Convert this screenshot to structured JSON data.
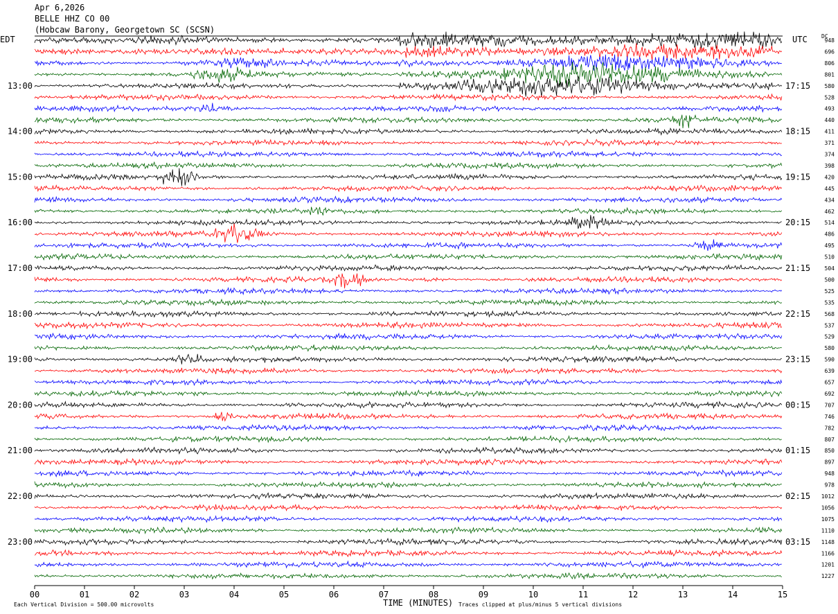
{
  "header": {
    "date": "Apr 6,2026",
    "station": "BELLE HHZ CO 00",
    "location": "(Hobcaw Barony, Georgetown SC (SCSN)"
  },
  "left_timezone": "EDT",
  "right_timezone": "UTC",
  "dc_header": "DC",
  "chart_data": {
    "type": "line",
    "subtype": "helicorder",
    "xlabel": "TIME (MINUTES)",
    "x_ticks": [
      "00",
      "01",
      "02",
      "03",
      "04",
      "05",
      "06",
      "07",
      "08",
      "09",
      "10",
      "11",
      "12",
      "13",
      "14",
      "15"
    ],
    "xlim": [
      0,
      15
    ],
    "rows_per_hour": 4,
    "minutes_per_row": 15,
    "row_count": 48,
    "trace_colors": [
      "#000000",
      "#ff0000",
      "#0000ff",
      "#006400"
    ],
    "left_hour_labels": [
      "13:00",
      "14:00",
      "15:00",
      "16:00",
      "17:00",
      "18:00",
      "19:00",
      "20:00",
      "21:00",
      "22:00",
      "23:00"
    ],
    "right_hour_labels": [
      "17:15",
      "18:15",
      "19:15",
      "20:15",
      "21:15",
      "22:15",
      "23:15",
      "00:15",
      "01:15",
      "02:15",
      "03:15"
    ],
    "dc_offsets": [
      948,
      696,
      806,
      801,
      580,
      528,
      493,
      440,
      411,
      371,
      374,
      398,
      420,
      445,
      434,
      462,
      514,
      486,
      495,
      510,
      504,
      500,
      525,
      535,
      568,
      537,
      529,
      580,
      590,
      639,
      657,
      692,
      707,
      746,
      782,
      807,
      850,
      897,
      948,
      978,
      1012,
      1056,
      1075,
      1110,
      1148,
      1166,
      1201,
      1227
    ],
    "scale_note": "Each Vertical Division =  500.00 microvolts",
    "clip_note": "Traces clipped at plus/minus 5 vertical divisions",
    "events": [
      {
        "row": 0,
        "start_min": 7.3,
        "end_min": 14.8,
        "amp": 2.6
      },
      {
        "row": 1,
        "start_min": 7.3,
        "end_min": 14.8,
        "amp": 2.3
      },
      {
        "row": 2,
        "start_min": 7.3,
        "end_min": 14.8,
        "amp": 2.0
      },
      {
        "row": 3,
        "start_min": 7.3,
        "end_min": 14.8,
        "amp": 2.6
      },
      {
        "row": 4,
        "start_min": 7.3,
        "end_min": 14.8,
        "amp": 2.4
      },
      {
        "row": 0,
        "start_min": 2.0,
        "end_min": 5.0,
        "amp": 1.8
      },
      {
        "row": 1,
        "start_min": 2.0,
        "end_min": 5.0,
        "amp": 1.8
      },
      {
        "row": 2,
        "start_min": 3.0,
        "end_min": 5.0,
        "amp": 1.6
      },
      {
        "row": 3,
        "start_min": 3.0,
        "end_min": 4.5,
        "amp": 1.8
      },
      {
        "row": 6,
        "start_min": 3.2,
        "end_min": 4.0,
        "amp": 2.2
      },
      {
        "row": 7,
        "start_min": 12.8,
        "end_min": 13.3,
        "amp": 2.0
      },
      {
        "row": 12,
        "start_min": 2.5,
        "end_min": 3.3,
        "amp": 2.6
      },
      {
        "row": 15,
        "start_min": 5.5,
        "end_min": 5.9,
        "amp": 1.8
      },
      {
        "row": 16,
        "start_min": 10.7,
        "end_min": 11.6,
        "amp": 1.8
      },
      {
        "row": 17,
        "start_min": 3.6,
        "end_min": 4.6,
        "amp": 2.4
      },
      {
        "row": 18,
        "start_min": 13.2,
        "end_min": 13.8,
        "amp": 2.0
      },
      {
        "row": 21,
        "start_min": 6.0,
        "end_min": 6.6,
        "amp": 2.2
      },
      {
        "row": 21,
        "start_min": 7.8,
        "end_min": 8.3,
        "amp": 1.2
      },
      {
        "row": 28,
        "start_min": 2.8,
        "end_min": 3.4,
        "amp": 1.8
      },
      {
        "row": 33,
        "start_min": 3.6,
        "end_min": 4.0,
        "amp": 2.2
      }
    ]
  }
}
